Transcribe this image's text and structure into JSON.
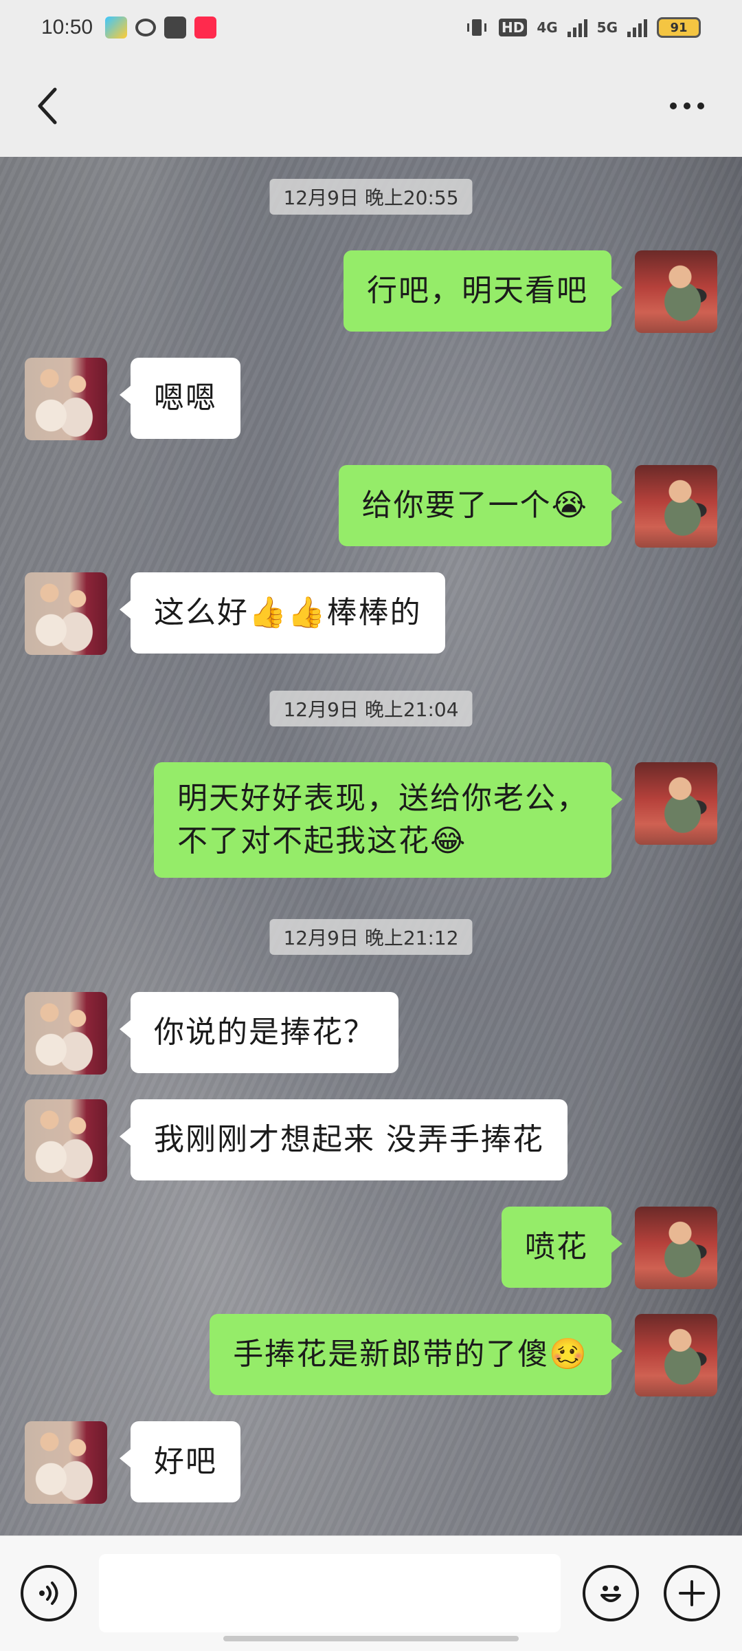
{
  "status_bar": {
    "time": "10:50",
    "network_4g": "4G",
    "network_5g": "5G",
    "hd": "HD",
    "battery": "91"
  },
  "nav": {
    "back_icon": "chevron-left-icon",
    "more_icon": "more-dots-icon"
  },
  "chat": {
    "timestamps": [
      "12月9日 晚上20:55",
      "12月9日 晚上21:04",
      "12月9日 晚上21:12"
    ],
    "messages": [
      {
        "from": "me",
        "text": "行吧，明天看吧"
      },
      {
        "from": "other",
        "text": "嗯嗯"
      },
      {
        "from": "me",
        "text": "给你要了一个😭"
      },
      {
        "from": "other",
        "text": "这么好👍👍棒棒的"
      },
      {
        "from": "me",
        "text": "明天好好表现，送给你老公，",
        "text2": "不了对不起我这花😂"
      },
      {
        "from": "other",
        "text": "你说的是捧花？"
      },
      {
        "from": "other",
        "text": "我刚刚才想起来 没弄手捧花"
      },
      {
        "from": "me",
        "text": "喷花"
      },
      {
        "from": "me",
        "text": "手捧花是新郎带的了傻🥴"
      },
      {
        "from": "other",
        "text": "好吧"
      }
    ]
  },
  "input_bar": {
    "voice_icon": "voice-icon",
    "emoji_icon": "emoji-icon",
    "plus_icon": "plus-icon",
    "placeholder": ""
  },
  "colors": {
    "my_bubble": "#95ec69",
    "other_bubble": "#ffffff",
    "background": "#ededed"
  }
}
